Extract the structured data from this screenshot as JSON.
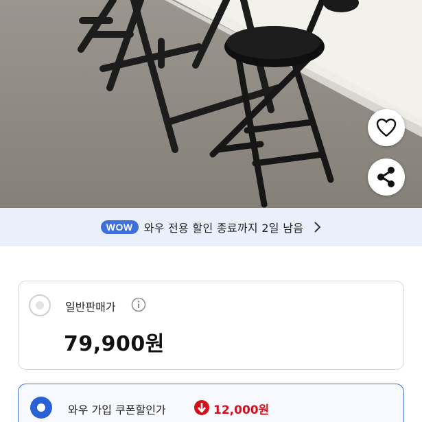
{
  "photo": {
    "alt": "folding chairs and table",
    "wall_color": "#f1efea",
    "floor_color": "#8d8a84",
    "frame_color": "#1e1e1e"
  },
  "actions": {
    "like_icon": "heart-outline-icon",
    "share_icon": "share-icon"
  },
  "wow_banner": {
    "badge": "WOW",
    "text": "와우 전용 할인 종료까지 2일 남음",
    "chevron_icon": "chevron-right-icon"
  },
  "options": [
    {
      "label": "일반판매가",
      "price": "79,900원",
      "selected": false,
      "info_icon": "info-icon"
    },
    {
      "label": "와우 가입 쿠폰할인가",
      "discount": "12,000원",
      "selected": true,
      "discount_icon": "arrow-down-circle-icon"
    }
  ],
  "colors": {
    "accent": "#3f6fd8",
    "discount_red": "#d0111b",
    "banner_bg": "#eaf0fb"
  }
}
